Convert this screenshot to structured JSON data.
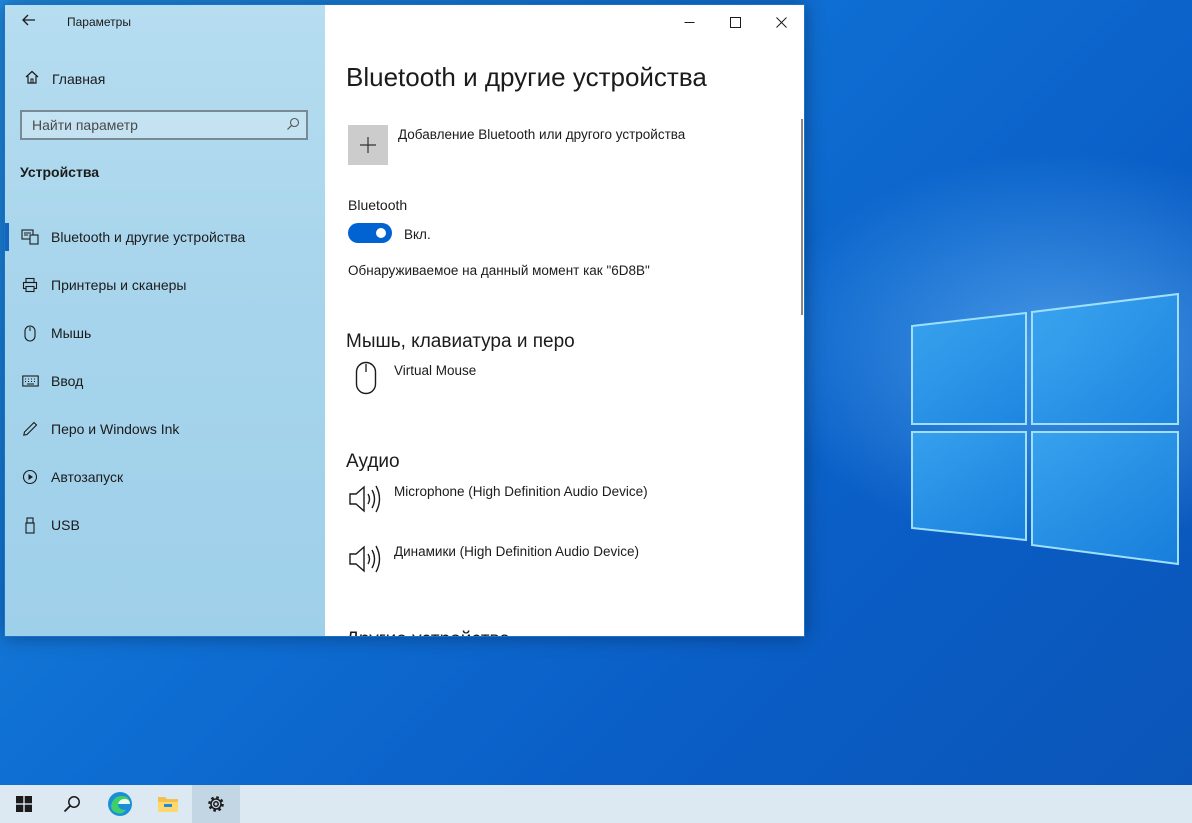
{
  "window": {
    "title": "Параметры",
    "caption": {
      "minimize": "–",
      "maximize": "☐",
      "close": "✕"
    }
  },
  "sidebar": {
    "back_icon": "arrow-left-icon",
    "home": {
      "label": "Главная",
      "icon": "home-icon"
    },
    "search": {
      "placeholder": "Найти параметр",
      "icon": "search-icon"
    },
    "section_title": "Устройства",
    "items": [
      {
        "label": "Bluetooth и другие устройства",
        "icon": "bluetooth-devices-icon",
        "active": true
      },
      {
        "label": "Принтеры и сканеры",
        "icon": "printer-icon",
        "active": false
      },
      {
        "label": "Мышь",
        "icon": "mouse-icon",
        "active": false
      },
      {
        "label": "Ввод",
        "icon": "keyboard-icon",
        "active": false
      },
      {
        "label": "Перо и Windows Ink",
        "icon": "pen-icon",
        "active": false
      },
      {
        "label": "Автозапуск",
        "icon": "autoplay-icon",
        "active": false
      },
      {
        "label": "USB",
        "icon": "usb-icon",
        "active": false
      }
    ]
  },
  "content": {
    "page_title": "Bluetooth и другие устройства",
    "add_device_label": "Добавление Bluetooth или другого устройства",
    "bluetooth_label": "Bluetooth",
    "toggle_state": "Вкл.",
    "toggle_on": true,
    "discoverable_text": "Обнаруживаемое на данный момент как \"6D8B\"",
    "sections": {
      "mouse_keyboard_pen": {
        "title": "Мышь, клавиатура и перо",
        "devices": [
          {
            "name": "Virtual Mouse",
            "icon": "mouse-icon"
          }
        ]
      },
      "audio": {
        "title": "Аудио",
        "devices": [
          {
            "name": "Microphone (High Definition Audio Device)",
            "icon": "speaker-icon"
          },
          {
            "name": "Динамики (High Definition Audio Device)",
            "icon": "speaker-icon"
          }
        ]
      },
      "other": {
        "title": "Другие устройства"
      }
    }
  },
  "taskbar": {
    "items": [
      {
        "name": "start",
        "icon": "windows-logo-icon"
      },
      {
        "name": "search",
        "icon": "search-icon"
      },
      {
        "name": "edge",
        "icon": "edge-browser-icon"
      },
      {
        "name": "explorer",
        "icon": "folder-icon"
      },
      {
        "name": "settings",
        "icon": "gear-icon",
        "active": true
      }
    ]
  },
  "colors": {
    "accent": "#0063d1",
    "sidebar_bg": "#a9d6ee",
    "taskbar_bg": "#dde9f2"
  }
}
